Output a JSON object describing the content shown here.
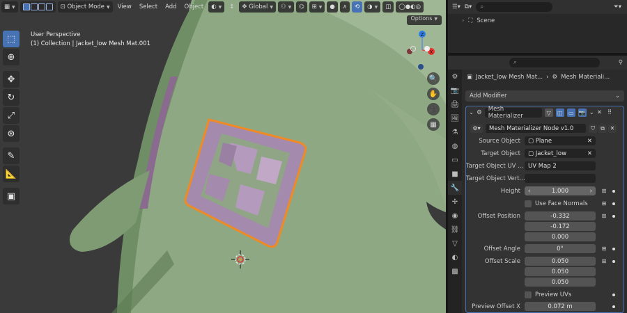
{
  "viewport": {
    "header": {
      "mode": "Object Mode",
      "menus": [
        "View",
        "Select",
        "Add",
        "Object"
      ],
      "orientation": "Global"
    },
    "options_label": "Options",
    "info_line1": "User Perspective",
    "info_line2": "(1) Collection | Jacket_low Mesh Mat.001",
    "gizmo": {
      "x": "X",
      "z": "Z"
    }
  },
  "outliner": {
    "search_placeholder": "",
    "scene_label": "Scene"
  },
  "properties": {
    "breadcrumb_object": "Jacket_low Mesh Mat...",
    "breadcrumb_modifier": "Mesh Materiali...",
    "add_modifier": "Add Modifier",
    "modifier": {
      "name": "Mesh Materializer",
      "node_group": "Mesh Materializer Node v1.0",
      "fields": {
        "source_object": {
          "label": "Source Object",
          "value": "Plane"
        },
        "target_object": {
          "label": "Target Object",
          "value": "Jacket_low"
        },
        "target_uv": {
          "label": "Target Object UV ...",
          "value": "UV Map 2"
        },
        "target_vert": {
          "label": "Target Object Vert...",
          "value": ""
        },
        "height": {
          "label": "Height",
          "value": "1.000"
        },
        "use_face_normals": {
          "label": "Use Face Normals"
        },
        "offset_position": {
          "label": "Offset Position",
          "values": [
            "-0.332",
            "-0.172",
            "0.000"
          ]
        },
        "offset_angle": {
          "label": "Offset Angle",
          "value": "0°"
        },
        "offset_scale": {
          "label": "Offset Scale",
          "values": [
            "0.050",
            "0.050",
            "0.050"
          ]
        },
        "preview_uvs": {
          "label": "Preview UVs"
        },
        "preview_offset_x": {
          "label": "Preview Offset X",
          "value": "0.072 m"
        }
      }
    }
  },
  "colors": {
    "accent": "#4772b3",
    "mesh_green": "#8aa57e",
    "mesh_purple": "#a48aac",
    "selection_orange": "#f08a24",
    "panel_bg": "#2b2b2b"
  }
}
